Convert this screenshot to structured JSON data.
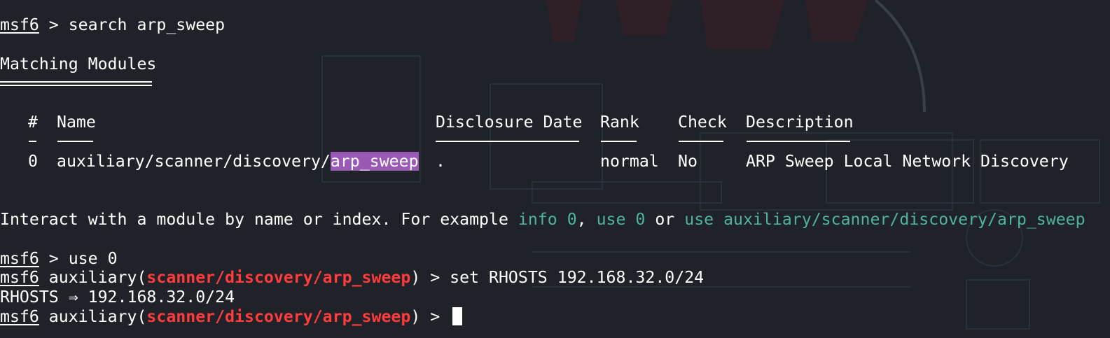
{
  "colors": {
    "background": "#1f2229",
    "text": "#ffffff",
    "module_path": "#ff3b3b",
    "hint": "#4fb49c",
    "search_highlight": "#9b59b6"
  },
  "terminal": {
    "prompt": "msf6",
    "cmd1": " > search arp_sweep",
    "section_title": "Matching Modules",
    "table": {
      "headers": [
        "#",
        "Name",
        "Disclosure Date",
        "Rank",
        "Check",
        "Description"
      ],
      "rows": [
        {
          "index": "0",
          "name_prefix": "auxiliary/scanner/discovery/",
          "name_match": "arp_sweep",
          "date": ".",
          "rank": "normal",
          "check": "No",
          "description": "ARP Sweep Local Network Discovery"
        }
      ]
    },
    "interact": {
      "text1": "Interact with a module by name or index. For example ",
      "hint1": "info 0",
      "sep1": ", ",
      "hint2": "use 0",
      "sep2": " or ",
      "hint3": "use auxiliary/scanner/discovery/arp_sweep"
    },
    "cmd2": " > use 0",
    "aux_open": " auxiliary(",
    "module_path": "scanner/discovery/arp_sweep",
    "aux_close": ") > ",
    "cmd3": "set RHOSTS 192.168.32.0/24",
    "output": "RHOSTS ⇒ 192.168.32.0/24"
  }
}
